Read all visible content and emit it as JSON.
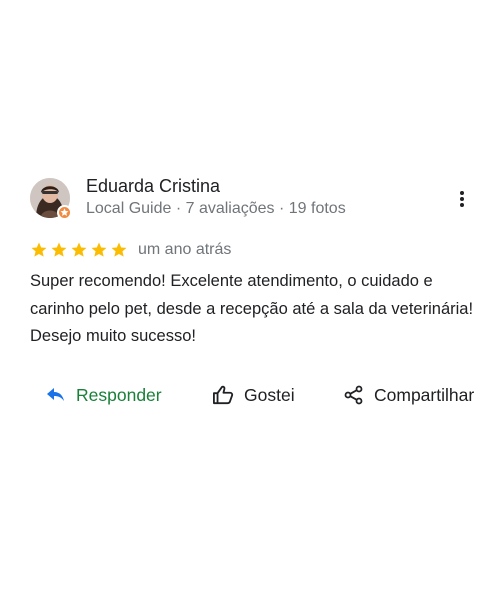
{
  "review": {
    "author": {
      "name": "Eduarda Cristina",
      "meta": "Local Guide · 7 avaliações · 19 fotos",
      "avatar_icon": "profile-photo",
      "badge_icon": "local-guide-star-badge",
      "badge_color": "#f28b42"
    },
    "menu_icon": "more-vert-icon",
    "rating": {
      "stars": 5,
      "max_stars": 5,
      "star_color": "#fbbc04",
      "date": "um ano atrás"
    },
    "text": "Super recomendo! Excelente atendimento, o cuidado e carinho pelo pet, desde a recepção até a sala da veterinária! Desejo muito sucesso!",
    "actions": {
      "reply": {
        "label": "Responder",
        "icon": "reply-arrow-icon",
        "color": "#188038"
      },
      "like": {
        "label": "Gostei",
        "icon": "thumb-up-icon"
      },
      "share": {
        "label": "Compartilhar",
        "icon": "share-icon"
      }
    }
  }
}
